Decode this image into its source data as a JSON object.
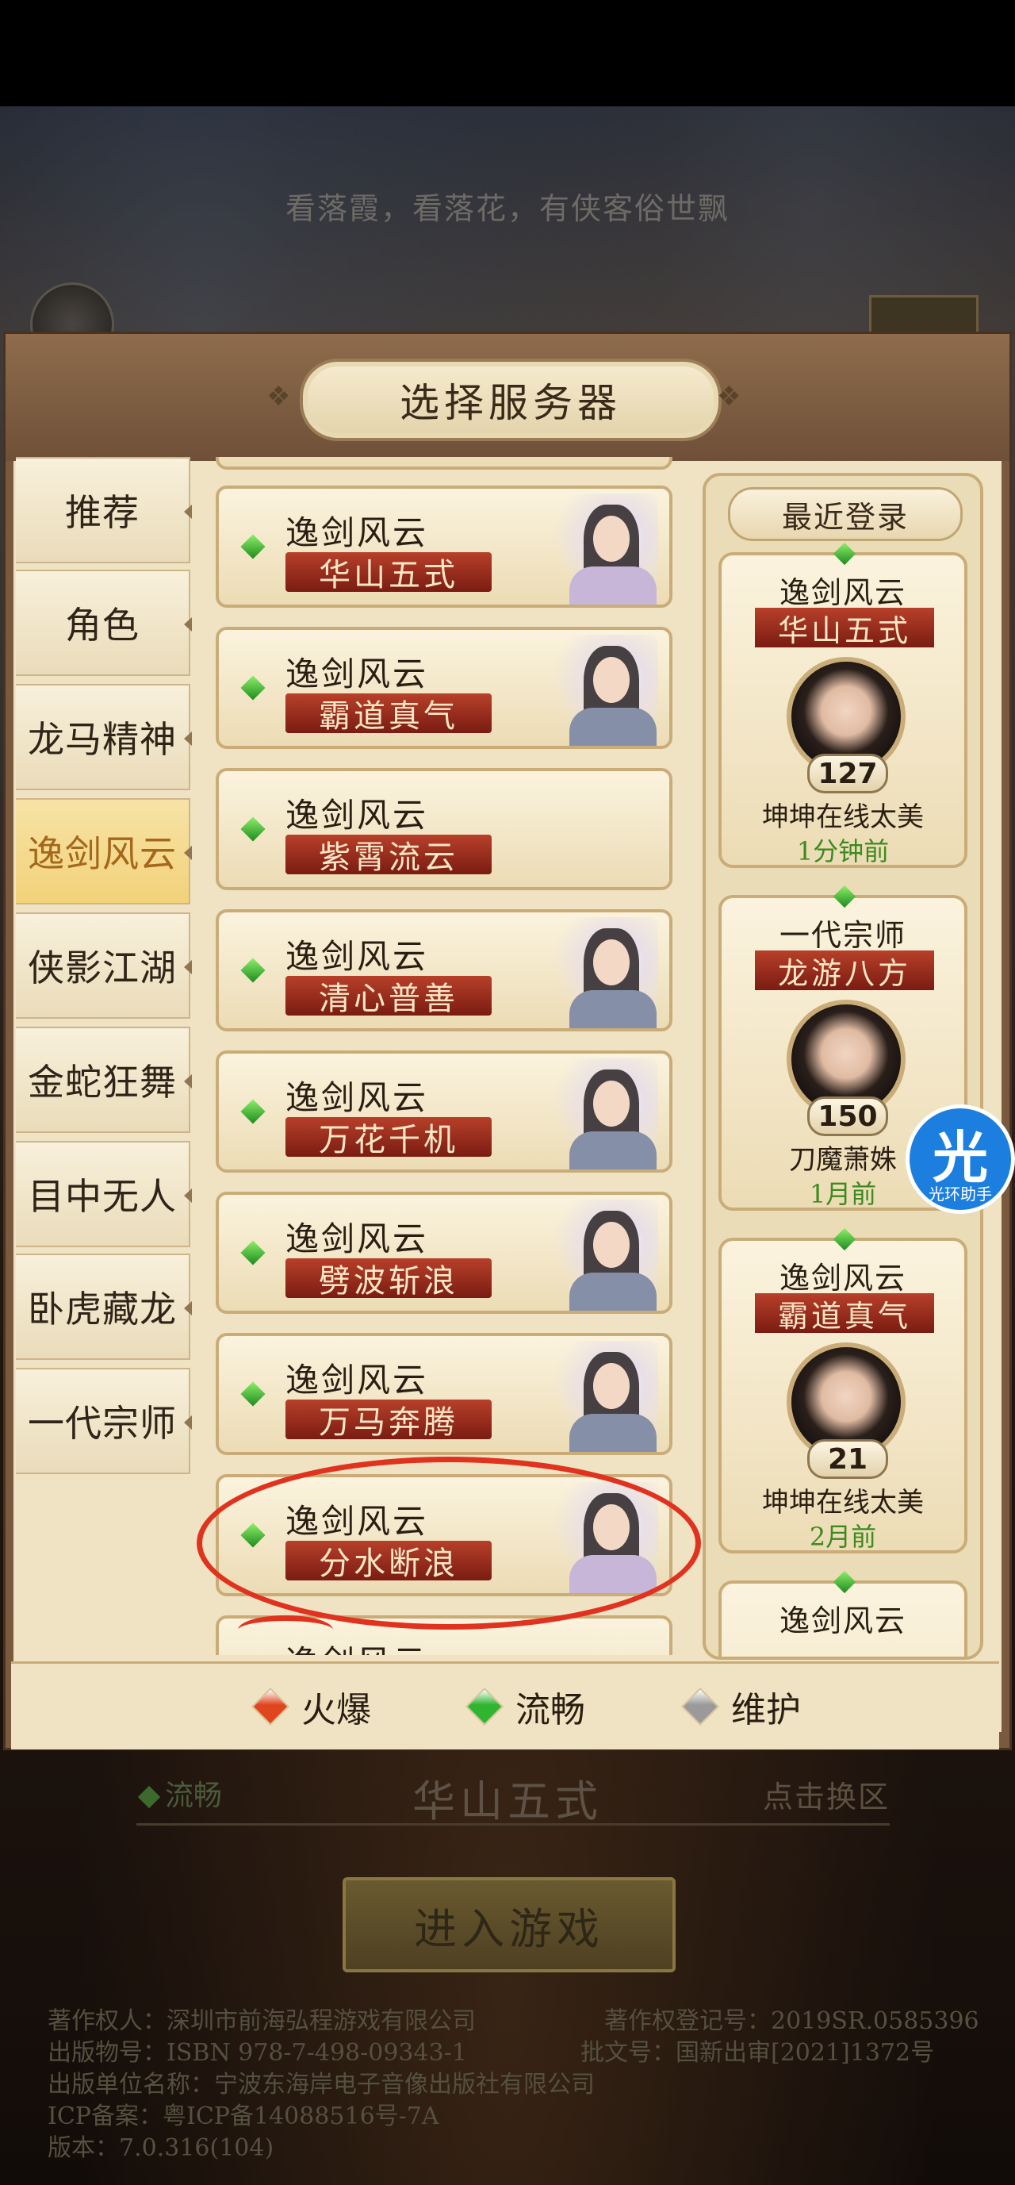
{
  "background": {
    "slogan": "看落霞，看落花，有侠客俗世飘"
  },
  "dialog": {
    "title": "选择服务器",
    "tabs": [
      {
        "label": "推荐",
        "active": false
      },
      {
        "label": "角色",
        "active": false
      },
      {
        "label": "龙马精神",
        "active": false
      },
      {
        "label": "逸剑风云",
        "active": true
      },
      {
        "label": "侠影江湖",
        "active": false
      },
      {
        "label": "金蛇狂舞",
        "active": false
      },
      {
        "label": "目中无人",
        "active": false
      },
      {
        "label": "卧虎藏龙",
        "active": false
      },
      {
        "label": "一代宗师",
        "active": false
      }
    ],
    "servers": [
      {
        "group": "逸剑风云",
        "zone": "华山五式",
        "status": "流畅",
        "portrait": "female-portrait"
      },
      {
        "group": "逸剑风云",
        "zone": "霸道真气",
        "status": "流畅",
        "portrait": "male-portrait"
      },
      {
        "group": "逸剑风云",
        "zone": "紫霄流云",
        "status": "流畅",
        "portrait": ""
      },
      {
        "group": "逸剑风云",
        "zone": "清心普善",
        "status": "流畅",
        "portrait": "male-portrait"
      },
      {
        "group": "逸剑风云",
        "zone": "万花千机",
        "status": "流畅",
        "portrait": "male-portrait"
      },
      {
        "group": "逸剑风云",
        "zone": "劈波斩浪",
        "status": "流畅",
        "portrait": "male-portrait"
      },
      {
        "group": "逸剑风云",
        "zone": "万马奔腾",
        "status": "流畅",
        "portrait": "male-portrait"
      },
      {
        "group": "逸剑风云",
        "zone": "分水断浪",
        "status": "流畅",
        "portrait": "female-portrait"
      },
      {
        "group": "逸剑风云",
        "zone": "",
        "status": "流畅",
        "portrait": ""
      }
    ],
    "recent": {
      "title": "最近登录",
      "cards": [
        {
          "server": "逸剑风云",
          "zone": "华山五式",
          "level": "127",
          "player": "坤坤在线太美",
          "time": "1分钟前"
        },
        {
          "server": "一代宗师",
          "zone": "龙游八方",
          "level": "150",
          "player": "刀魔萧姝",
          "time": "1月前"
        },
        {
          "server": "逸剑风云",
          "zone": "霸道真气",
          "level": "21",
          "player": "坤坤在线太美",
          "time": "2月前"
        },
        {
          "server": "逸剑风云",
          "zone": "",
          "level": "",
          "player": "",
          "time": ""
        }
      ]
    },
    "legend": [
      {
        "label": "火爆",
        "color": "#e0461e"
      },
      {
        "label": "流畅",
        "color": "#2fb52f"
      },
      {
        "label": "维护",
        "color": "#9a9a9a"
      }
    ]
  },
  "bottom": {
    "status_label": "流畅",
    "current_server": "华山五式",
    "switch_label": "点击换区",
    "enter_label": "进入游戏",
    "copyright": [
      "著作权人：深圳市前海弘程游戏有限公司",
      "著作权登记号：2019SR.0585396",
      "出版物号：ISBN 978-7-498-09343-1",
      "批文号：国新出审[2021]1372号",
      "出版单位名称：宁波东海岸电子音像出版社有限公司",
      "ICP备案：粤ICP备14088516号-7A",
      "版本：7.0.316(104)"
    ]
  },
  "assistant": {
    "glyph": "光",
    "label": "光环助手"
  }
}
